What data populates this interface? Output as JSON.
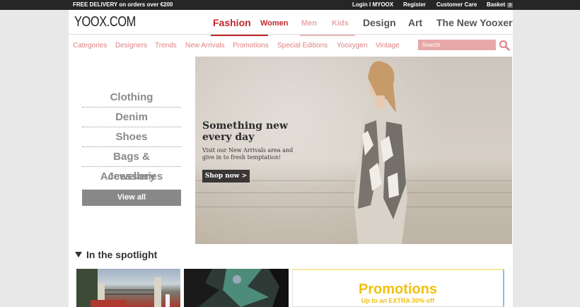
{
  "topbar": {
    "promo": "FREE DELIVERY on orders over €200",
    "login": "Login I MYOOX",
    "register": "Register",
    "customer_care": "Customer Care",
    "basket": "Basket",
    "basket_count": "0"
  },
  "header": {
    "logo": "YOOX.COM",
    "nav": {
      "fashion": "Fashion",
      "women": "Women",
      "men": "Men",
      "kids": "Kids",
      "design": "Design",
      "art": "Art",
      "new_yooxer": "The New Yooxer"
    },
    "subnav": {
      "categories": "Categories",
      "designers": "Designers",
      "trends": "Trends",
      "new_arrivals": "New Arrivals",
      "promotions": "Promotions",
      "special_editions": "Special Editions",
      "yooxygen": "Yooxygen",
      "vintage": "Vintage"
    },
    "search_placeholder": "Search"
  },
  "categories": {
    "items": [
      "Clothing",
      "Denim",
      "Shoes",
      "Bags & Accessories",
      "Jewellery"
    ],
    "view_all": "View all"
  },
  "hero": {
    "title": "Something new every day",
    "body": "Visit our New Arrivals area and give in to fresh temptation!",
    "cta": "Shop now >"
  },
  "spotlight": {
    "title": "In the spotlight",
    "promo_title": "Promotions",
    "promo_sub": "Up to an EXTRA 30% off"
  },
  "colors": {
    "accent_red": "#c0272d",
    "pink": "#e08080",
    "promo_yellow": "#f2c010"
  }
}
